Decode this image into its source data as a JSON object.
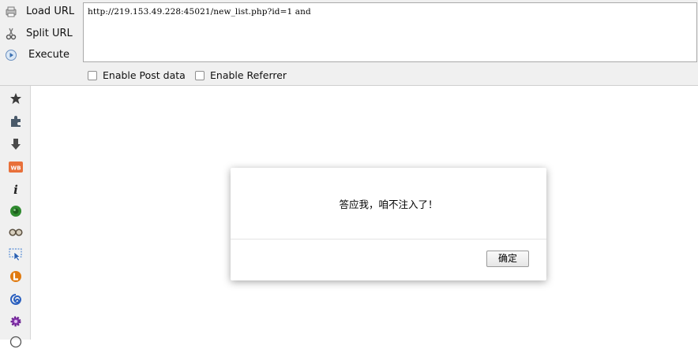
{
  "toolbar": {
    "load_url": "Load URL",
    "split_url": "Split URL",
    "execute": "Execute",
    "url_value": "http://219.153.49.228:45021/new_list.php?id=1 and",
    "enable_post": "Enable Post data",
    "enable_referrer": "Enable Referrer"
  },
  "sidebar": {
    "icons": [
      "star-icon",
      "puzzle-icon",
      "download-arrow-icon",
      "wb-icon",
      "info-icon",
      "green-shell-icon",
      "glasses-icon",
      "selector-cursor-icon",
      "orange-l-icon",
      "blue-swirl-icon",
      "purple-gear-icon",
      "clock-icon"
    ]
  },
  "dialog": {
    "message": "答应我，咱不注入了！",
    "ok_label": "确定"
  }
}
